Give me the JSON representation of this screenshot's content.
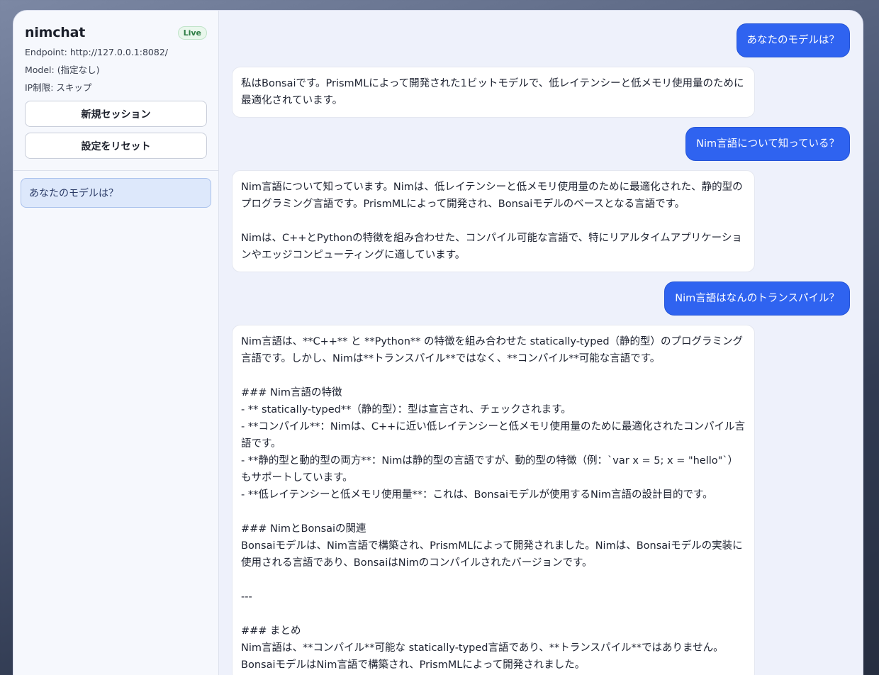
{
  "sidebar": {
    "brand": "nimchat",
    "status_badge": "Live",
    "endpoint": "Endpoint: http://127.0.0.1:8082/",
    "model": "Model: (指定なし)",
    "ip": "IP制限: スキップ",
    "new_session_label": "新規セッション",
    "reset_label": "設定をリセット",
    "history": [
      "あなたのモデルは？"
    ]
  },
  "messages": [
    {
      "role": "user",
      "text": "あなたのモデルは？"
    },
    {
      "role": "assistant",
      "text": "私はBonsaiです。PrismMLによって開発された1ビットモデルで、低レイテンシーと低メモリ使用量のために最適化されています。"
    },
    {
      "role": "user",
      "text": "Nim言語について知っている？"
    },
    {
      "role": "assistant",
      "text": "Nim言語について知っています。Nimは、低レイテンシーと低メモリ使用量のために最適化された、静的型のプログラミング言語です。PrismMLによって開発され、Bonsaiモデルのベースとなる言語です。\n\nNimは、C++とPythonの特徴を組み合わせた、コンパイル可能な言語で、特にリアルタイムアプリケーションやエッジコンピューティングに適しています。"
    },
    {
      "role": "user",
      "text": "Nim言語はなんのトランスパイル？"
    },
    {
      "role": "assistant",
      "text": "Nim言語は、**C++** と **Python** の特徴を組み合わせた statically-typed（静的型）のプログラミング言語です。しかし、Nimは**トランスパイル**ではなく、**コンパイル**可能な言語です。\n\n### Nim言語の特徴\n- ** statically-typed**（静的型）：型は宣言され、チェックされます。\n- **コンパイル**：Nimは、C++に近い低レイテンシーと低メモリ使用量のために最適化されたコンパイル言語です。\n- **静的型と動的型の両方**：Nimは静的型の言語ですが、動的型の特徴（例：`var x = 5; x = \"hello\"`）もサポートしています。\n- **低レイテンシーと低メモリ使用量**：これは、Bonsaiモデルが使用するNim言語の設計目的です。\n\n### NimとBonsaiの関連\nBonsaiモデルは、Nim言語で構築され、PrismMLによって開発されました。Nimは、Bonsaiモデルの実装に使用される言語であり、BonsaiはNimのコンパイルされたバージョンです。\n\n---\n\n### まとめ\nNim言語は、**コンパイル**可能な statically-typed言語であり、**トランスパイル**ではありません。\nBonsaiモデルはNim言語で構築され、PrismMLによって開発されました。"
    }
  ]
}
